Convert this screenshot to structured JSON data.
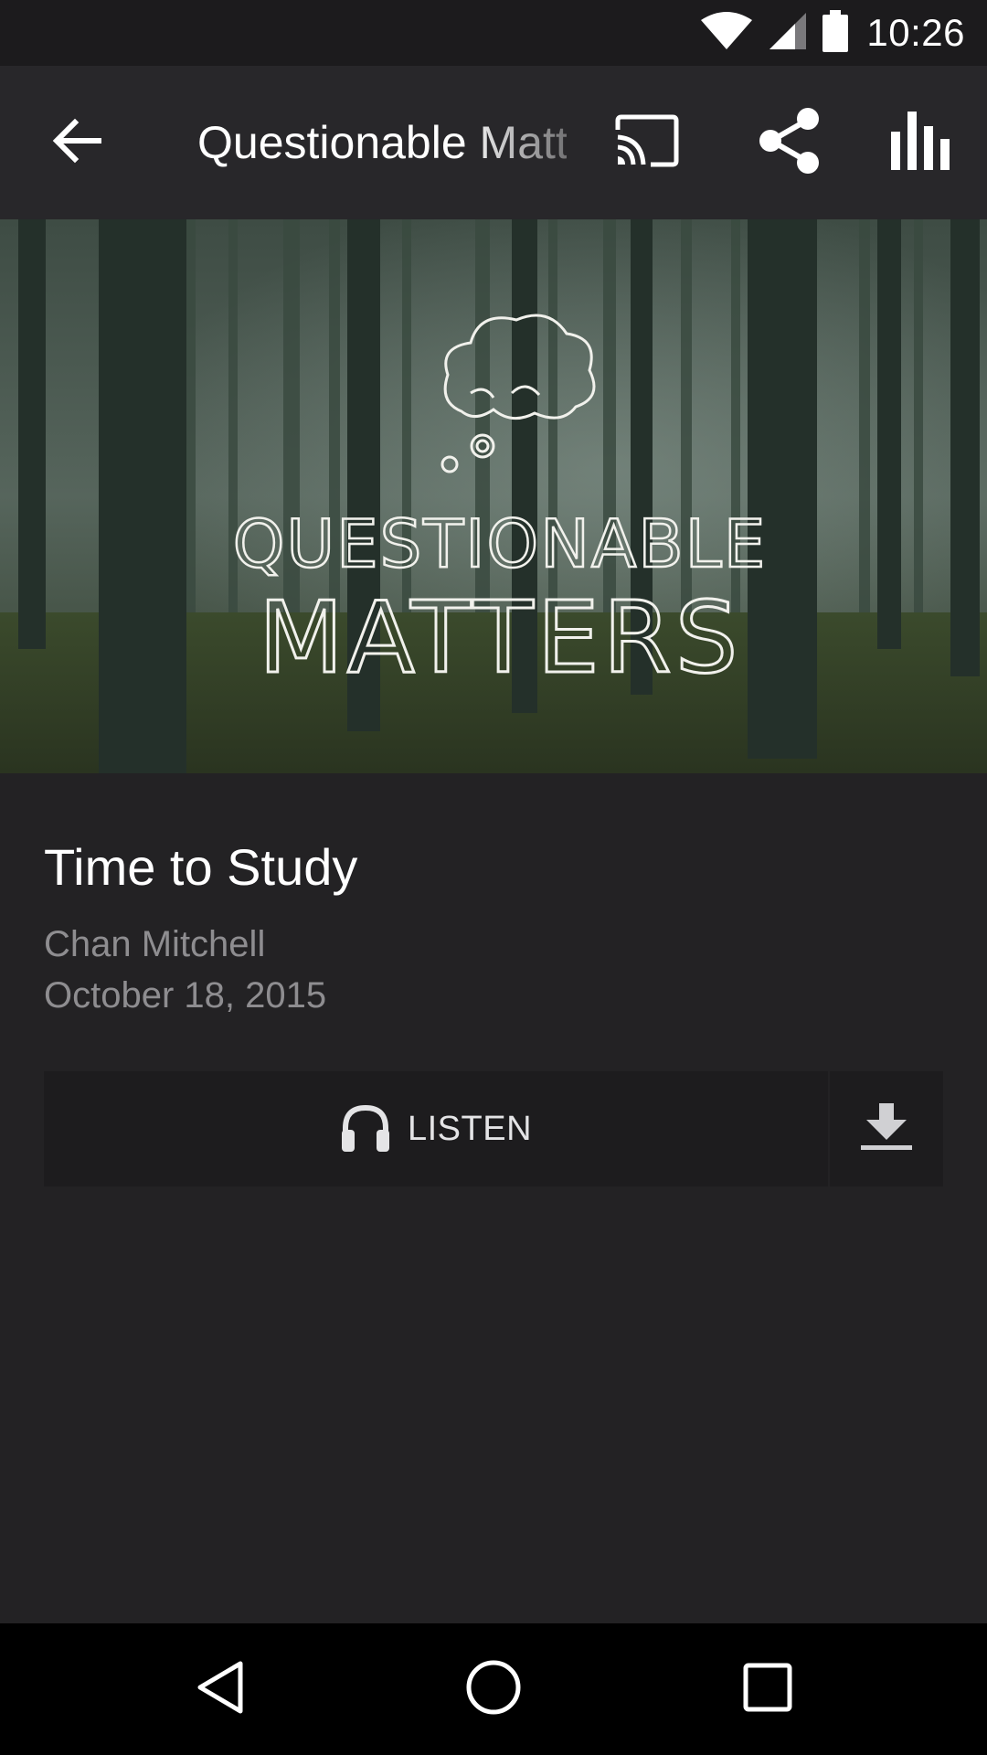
{
  "status_bar": {
    "time": "10:26",
    "icons": [
      "wifi-icon",
      "cell-signal-icon",
      "battery-icon"
    ]
  },
  "toolbar": {
    "title": "Questionable Matters",
    "actions": [
      "back-arrow-icon",
      "cast-icon",
      "share-icon",
      "equalizer-icon"
    ]
  },
  "hero": {
    "artwork_title_line1": "QUESTIONABLE",
    "artwork_title_line2": "MATTERS"
  },
  "episode": {
    "title": "Time to Study",
    "author": "Chan Mitchell",
    "date": "October 18, 2015"
  },
  "actions": {
    "listen_label": "LISTEN",
    "listen_icon": "headphones-icon",
    "download_icon": "download-icon"
  },
  "nav_bar": {
    "buttons": [
      "back-triangle-icon",
      "home-circle-icon",
      "recents-square-icon"
    ]
  },
  "colors": {
    "background": "#232224",
    "toolbar": "#28272a",
    "button": "#1d1c1e",
    "secondary_text": "#8e8d90"
  }
}
